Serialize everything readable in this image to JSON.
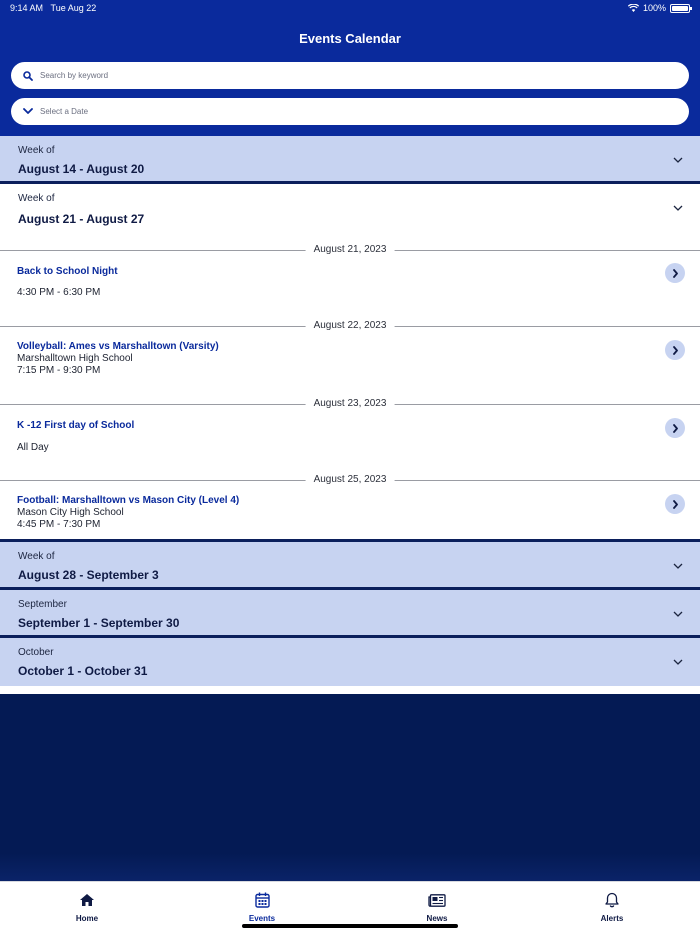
{
  "status": {
    "time": "9:14 AM",
    "date": "Tue Aug 22",
    "battery": "100%"
  },
  "header": {
    "title": "Events Calendar"
  },
  "search": {
    "placeholder": "Search by keyword"
  },
  "date_select": {
    "placeholder": "Select a Date"
  },
  "weeks": [
    {
      "label": "Week of",
      "range": "August 14 - August 20"
    },
    {
      "label": "Week of",
      "range": "August 21 - August 27"
    },
    {
      "label": "Week of",
      "range": "August 28 - September 3"
    },
    {
      "label": "September",
      "range": "September 1 - September 30"
    },
    {
      "label": "October",
      "range": "October 1 - October 31"
    }
  ],
  "days": [
    {
      "date": "August 21, 2023",
      "event": {
        "title": "Back to School Night",
        "location": "",
        "time": "4:30 PM - 6:30 PM"
      }
    },
    {
      "date": "August 22, 2023",
      "event": {
        "title": "Volleyball: Ames vs Marshalltown (Varsity)",
        "location": "Marshalltown High School",
        "time": "7:15 PM - 9:30 PM"
      }
    },
    {
      "date": "August 23, 2023",
      "event": {
        "title": "K -12 First day of School",
        "location": "",
        "time": "All Day"
      }
    },
    {
      "date": "August 25, 2023",
      "event": {
        "title": "Football: Marshalltown vs Mason City (Level 4)",
        "location": "Mason City High School",
        "time": "4:45 PM - 7:30 PM"
      }
    }
  ],
  "tabs": [
    {
      "label": "Home",
      "icon": "home-icon",
      "active": false
    },
    {
      "label": "Events",
      "icon": "calendar-icon",
      "active": true
    },
    {
      "label": "News",
      "icon": "newspaper-icon",
      "active": false
    },
    {
      "label": "Alerts",
      "icon": "bell-icon",
      "active": false
    }
  ],
  "colors": {
    "brand": "#0a2a9c",
    "navy": "#041a54",
    "week_bg": "#c7d3f1"
  }
}
